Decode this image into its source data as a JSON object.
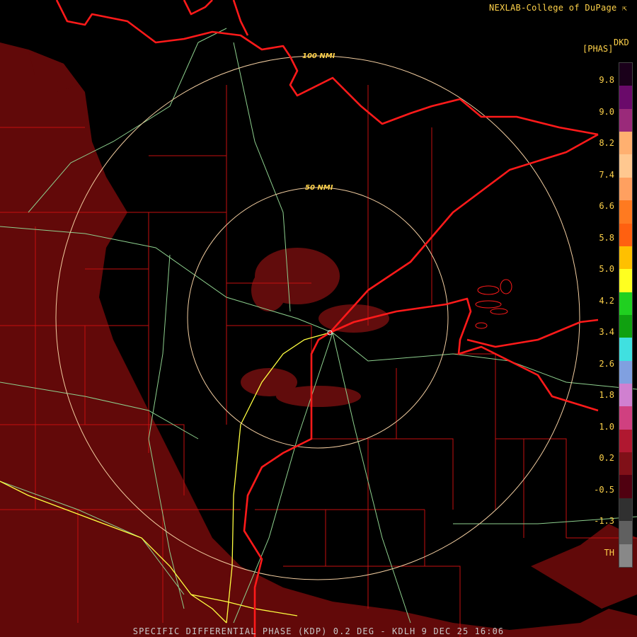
{
  "header": {
    "credit": "NEXLAB-College of DuPage",
    "credit_icon": "external-link-icon"
  },
  "legend": {
    "unit": "[PHAS]",
    "product_code": "DKD",
    "ticks": [
      "9.8",
      "9.0",
      "8.2",
      "7.4",
      "6.6",
      "5.8",
      "5.0",
      "4.2",
      "3.4",
      "2.6",
      "1.8",
      "1.0",
      "0.2",
      "-0.5",
      "-1.3",
      "TH"
    ],
    "colors": [
      "#1a001a",
      "#6a0a6a",
      "#9a2a7a",
      "#ffb070",
      "#ffc890",
      "#ffa060",
      "#ff7a20",
      "#ff6010",
      "#ffc000",
      "#ffff20",
      "#20d020",
      "#10a010",
      "#40e0e0",
      "#80a0e0",
      "#d080d0",
      "#d04080",
      "#b01830",
      "#801018",
      "#500010",
      "#303030",
      "#606060",
      "#888888"
    ]
  },
  "rings": [
    {
      "label": "50 NMI",
      "color": "#f2cda0"
    },
    {
      "label": "100 NMI",
      "color": "#f2cda0"
    }
  ],
  "map_colors": {
    "background": "#000000",
    "echo": "#6a0a0a",
    "state_border": "#ff1a1a",
    "county_line": "#c41010",
    "highway": "#8ed08e",
    "interstate": "#ffff40"
  },
  "footer": {
    "caption": "SPECIFIC DIFFERENTIAL PHASE (KDP) 0.2 DEG - KDLH 9 DEC 25 16:06"
  }
}
